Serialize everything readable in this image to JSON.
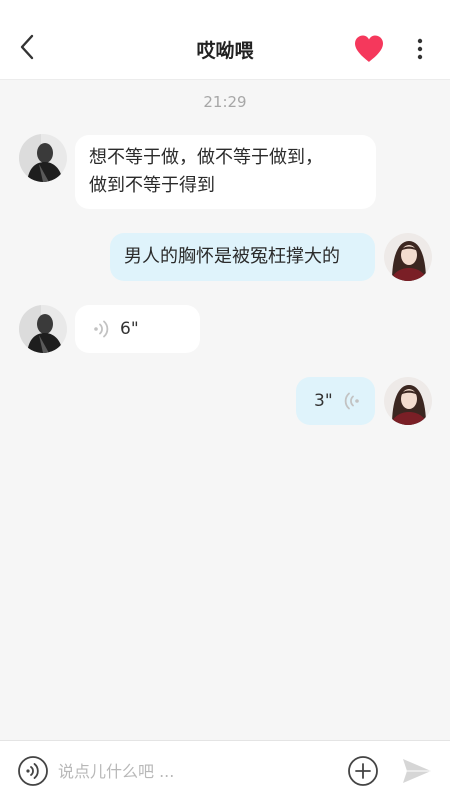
{
  "header": {
    "title": "哎呦喂",
    "back_icon": "chevron-left-icon",
    "favorite_icon": "heart-icon",
    "favorite_color": "#f5385c",
    "more_icon": "more-vertical-icon"
  },
  "conversation": {
    "timestamp": "21:29",
    "messages": [
      {
        "sender": "other",
        "type": "text",
        "lines": [
          "想不等于做，做不等于做到，",
          "做到不等于得到"
        ]
      },
      {
        "sender": "me",
        "type": "text",
        "text": "男人的胸怀是被冤枉撑大的"
      },
      {
        "sender": "other",
        "type": "voice",
        "duration": "6\""
      },
      {
        "sender": "me",
        "type": "voice",
        "duration": "3\""
      }
    ]
  },
  "input_bar": {
    "placeholder": "说点儿什么吧 ...",
    "voice_icon": "voice-input-icon",
    "add_icon": "plus-circle-icon",
    "send_icon": "send-icon"
  },
  "colors": {
    "my_bubble": "#dff3fb",
    "other_bubble": "#ffffff",
    "background": "#f6f6f6"
  }
}
